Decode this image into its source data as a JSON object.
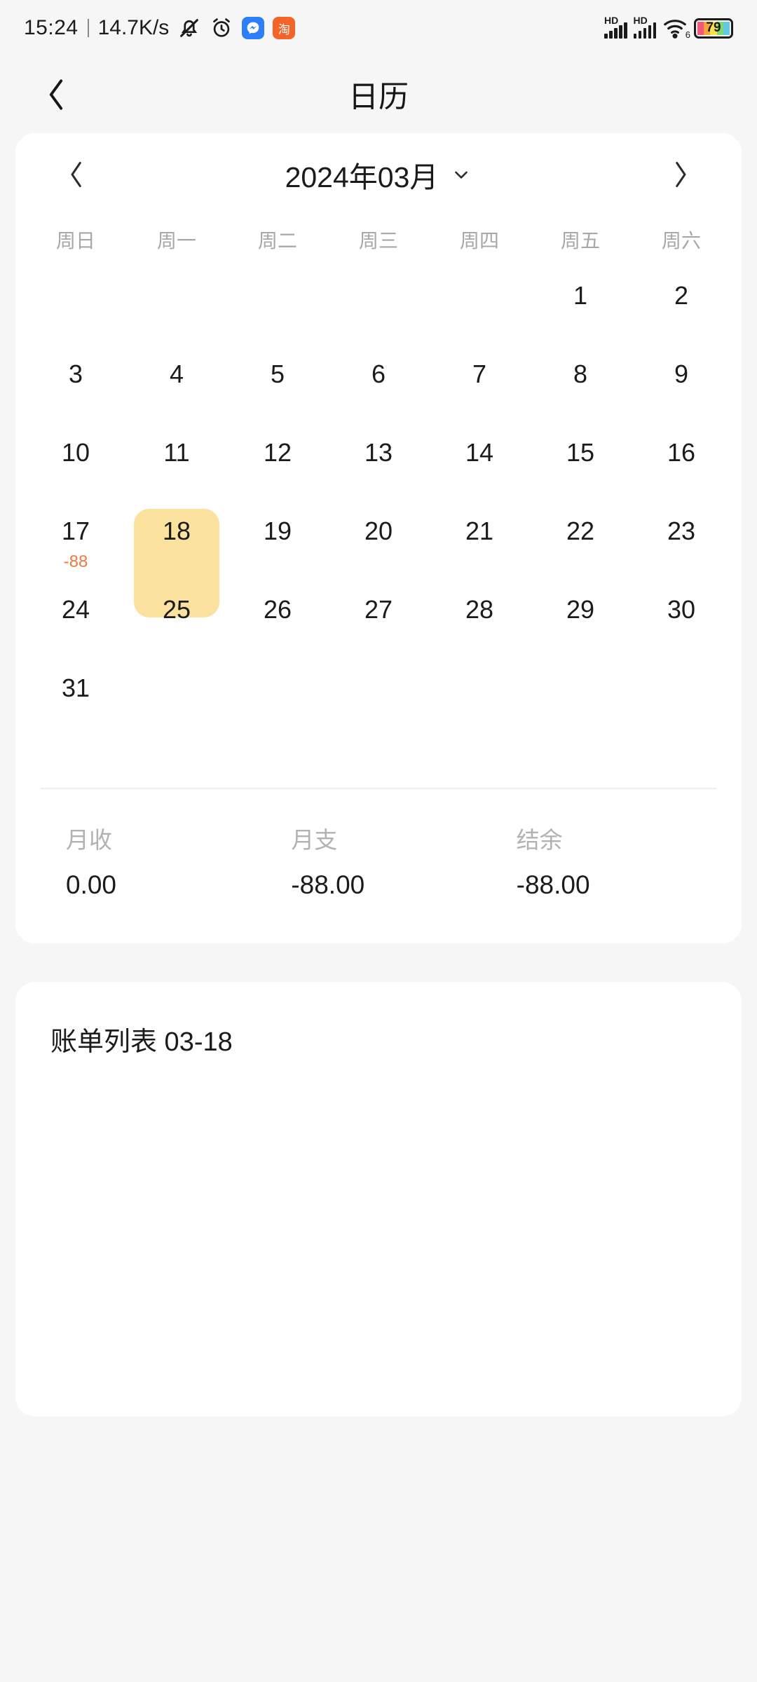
{
  "statusbar": {
    "time": "15:24",
    "network_speed": "14.7K/s",
    "icons": [
      "mute-icon",
      "alarm-icon"
    ],
    "app_badges": [
      {
        "name": "messenger-app-icon",
        "glyph": "≈",
        "color": "#2d7ff9"
      },
      {
        "name": "taobao-app-icon",
        "glyph": "淘",
        "color": "#f4642a"
      }
    ],
    "signal_labels": [
      "HD",
      "HD"
    ],
    "wifi_generation": "6",
    "battery_percent": "79"
  },
  "header": {
    "title": "日历",
    "back_icon": "chevron-left-icon"
  },
  "calendar": {
    "prev_icon": "chevron-left-icon",
    "next_icon": "chevron-right-icon",
    "dropdown_icon": "chevron-down-icon",
    "month_label": "2024年03月",
    "year": "2024",
    "month": "03",
    "weekdays": [
      "周日",
      "周一",
      "周二",
      "周三",
      "周四",
      "周五",
      "周六"
    ],
    "selected_day": "18",
    "selected_color": "#fbe29f",
    "amount_color": "#ef7a3d",
    "days": [
      {
        "day": "",
        "amount": "",
        "selected": false,
        "empty": true
      },
      {
        "day": "",
        "amount": "",
        "selected": false,
        "empty": true
      },
      {
        "day": "",
        "amount": "",
        "selected": false,
        "empty": true
      },
      {
        "day": "",
        "amount": "",
        "selected": false,
        "empty": true
      },
      {
        "day": "",
        "amount": "",
        "selected": false,
        "empty": true
      },
      {
        "day": "1",
        "amount": "",
        "selected": false,
        "empty": false
      },
      {
        "day": "2",
        "amount": "",
        "selected": false,
        "empty": false
      },
      {
        "day": "3",
        "amount": "",
        "selected": false,
        "empty": false
      },
      {
        "day": "4",
        "amount": "",
        "selected": false,
        "empty": false
      },
      {
        "day": "5",
        "amount": "",
        "selected": false,
        "empty": false
      },
      {
        "day": "6",
        "amount": "",
        "selected": false,
        "empty": false
      },
      {
        "day": "7",
        "amount": "",
        "selected": false,
        "empty": false
      },
      {
        "day": "8",
        "amount": "",
        "selected": false,
        "empty": false
      },
      {
        "day": "9",
        "amount": "",
        "selected": false,
        "empty": false
      },
      {
        "day": "10",
        "amount": "",
        "selected": false,
        "empty": false
      },
      {
        "day": "11",
        "amount": "",
        "selected": false,
        "empty": false
      },
      {
        "day": "12",
        "amount": "",
        "selected": false,
        "empty": false
      },
      {
        "day": "13",
        "amount": "",
        "selected": false,
        "empty": false
      },
      {
        "day": "14",
        "amount": "",
        "selected": false,
        "empty": false
      },
      {
        "day": "15",
        "amount": "",
        "selected": false,
        "empty": false
      },
      {
        "day": "16",
        "amount": "",
        "selected": false,
        "empty": false
      },
      {
        "day": "17",
        "amount": "-88",
        "selected": false,
        "empty": false
      },
      {
        "day": "18",
        "amount": "",
        "selected": true,
        "empty": false
      },
      {
        "day": "19",
        "amount": "",
        "selected": false,
        "empty": false
      },
      {
        "day": "20",
        "amount": "",
        "selected": false,
        "empty": false
      },
      {
        "day": "21",
        "amount": "",
        "selected": false,
        "empty": false
      },
      {
        "day": "22",
        "amount": "",
        "selected": false,
        "empty": false
      },
      {
        "day": "23",
        "amount": "",
        "selected": false,
        "empty": false
      },
      {
        "day": "24",
        "amount": "",
        "selected": false,
        "empty": false
      },
      {
        "day": "25",
        "amount": "",
        "selected": false,
        "empty": false
      },
      {
        "day": "26",
        "amount": "",
        "selected": false,
        "empty": false
      },
      {
        "day": "27",
        "amount": "",
        "selected": false,
        "empty": false
      },
      {
        "day": "28",
        "amount": "",
        "selected": false,
        "empty": false
      },
      {
        "day": "29",
        "amount": "",
        "selected": false,
        "empty": false
      },
      {
        "day": "30",
        "amount": "",
        "selected": false,
        "empty": false
      },
      {
        "day": "31",
        "amount": "",
        "selected": false,
        "empty": false
      },
      {
        "day": "",
        "amount": "",
        "selected": false,
        "empty": true
      },
      {
        "day": "",
        "amount": "",
        "selected": false,
        "empty": true
      },
      {
        "day": "",
        "amount": "",
        "selected": false,
        "empty": true
      },
      {
        "day": "",
        "amount": "",
        "selected": false,
        "empty": true
      },
      {
        "day": "",
        "amount": "",
        "selected": false,
        "empty": true
      },
      {
        "day": "",
        "amount": "",
        "selected": false,
        "empty": true
      }
    ]
  },
  "summary": {
    "income_label": "月收",
    "income_value": "0.00",
    "expense_label": "月支",
    "expense_value": "-88.00",
    "balance_label": "结余",
    "balance_value": "-88.00"
  },
  "bill_list": {
    "title": "账单列表 03-18",
    "items": []
  }
}
